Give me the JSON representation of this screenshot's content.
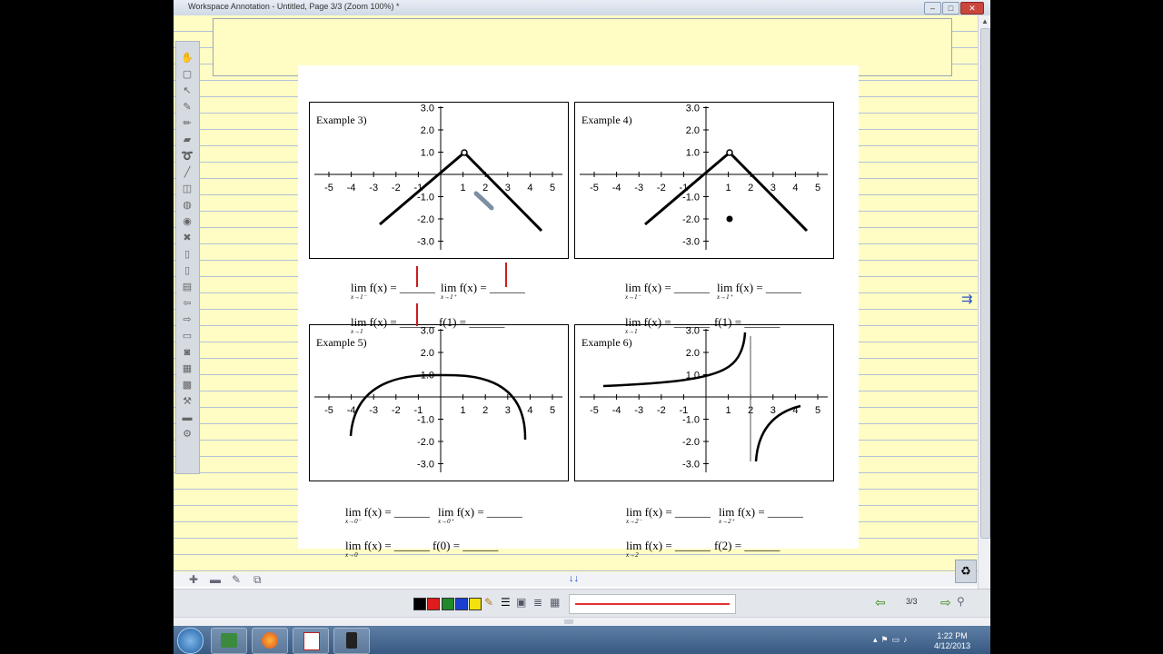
{
  "window": {
    "title": "Workspace Annotation - Untitled, Page 3/3  (Zoom 100%) *",
    "min": "–",
    "max": "□",
    "close": "✕"
  },
  "side_arrow": "⇉",
  "scroll_up": "▲",
  "scroll_down": "▼",
  "down_arrows": "↓↓",
  "graphs": [
    {
      "label": "Example 3)",
      "y_ticks": [
        "3.0",
        "2.0",
        "1.0",
        "-1.0",
        "-2.0",
        "-3.0"
      ],
      "x_ticks": [
        "-5",
        "-4",
        "-3",
        "-2",
        "-1",
        "1",
        "2",
        "3",
        "4",
        "5"
      ]
    },
    {
      "label": "Example 4)",
      "y_ticks": [
        "3.0",
        "2.0",
        "1.0",
        "-1.0",
        "-2.0",
        "-3.0"
      ],
      "x_ticks": [
        "-5",
        "-4",
        "-3",
        "-2",
        "-1",
        "1",
        "2",
        "3",
        "4",
        "5"
      ]
    },
    {
      "label": "Example 5)",
      "y_ticks": [
        "3.0",
        "2.0",
        "1.0",
        "-1.0",
        "-2.0",
        "-3.0"
      ],
      "x_ticks": [
        "-5",
        "-4",
        "-3",
        "-2",
        "-1",
        "1",
        "2",
        "3",
        "4",
        "5"
      ]
    },
    {
      "label": "Example 6)",
      "y_ticks": [
        "3.0",
        "2.0",
        "1.0",
        "-1.0",
        "-2.0",
        "-3.0"
      ],
      "x_ticks": [
        "-5",
        "-4",
        "-3",
        "-2",
        "-1",
        "1",
        "2",
        "3",
        "4",
        "5"
      ]
    }
  ],
  "limits": {
    "ex3": {
      "a": "lim f(x) = ______",
      "a_sub": "x→1⁻",
      "b": "lim f(x) = ______",
      "b_sub": "x→1⁺",
      "c": "lim f(x) = ______",
      "c_sub": "x→1",
      "d": "f(1) = ______"
    },
    "ex4": {
      "a": "lim f(x) = ______",
      "a_sub": "x→1⁻",
      "b": "lim f(x) = ______",
      "b_sub": "x→1⁺",
      "c": "lim f(x) = ______",
      "c_sub": "x→1",
      "d": "f(1) = ______"
    },
    "ex5": {
      "a": "lim f(x) = ______",
      "a_sub": "x→0⁻",
      "b": "lim f(x) = ______",
      "b_sub": "x→0⁺",
      "c": "lim f(x) = ______",
      "c_sub": "x→0",
      "d": "f(0) = ______"
    },
    "ex6": {
      "a": "lim f(x) = ______",
      "a_sub": "x→2⁻",
      "b": "lim f(x) = ______",
      "b_sub": "x→2⁺",
      "c": "lim f(x) = ______",
      "c_sub": "x→2",
      "d": "f(2) = ______"
    }
  },
  "toolbar": {
    "colors": [
      "#000000",
      "#e01b1b",
      "#1f8a2a",
      "#1a3fd0",
      "#f3e10f"
    ],
    "page_indicator": "3/3",
    "prev": "⇦",
    "next": "⇨"
  },
  "clock": {
    "time": "1:22 PM",
    "date": "4/12/2013"
  }
}
